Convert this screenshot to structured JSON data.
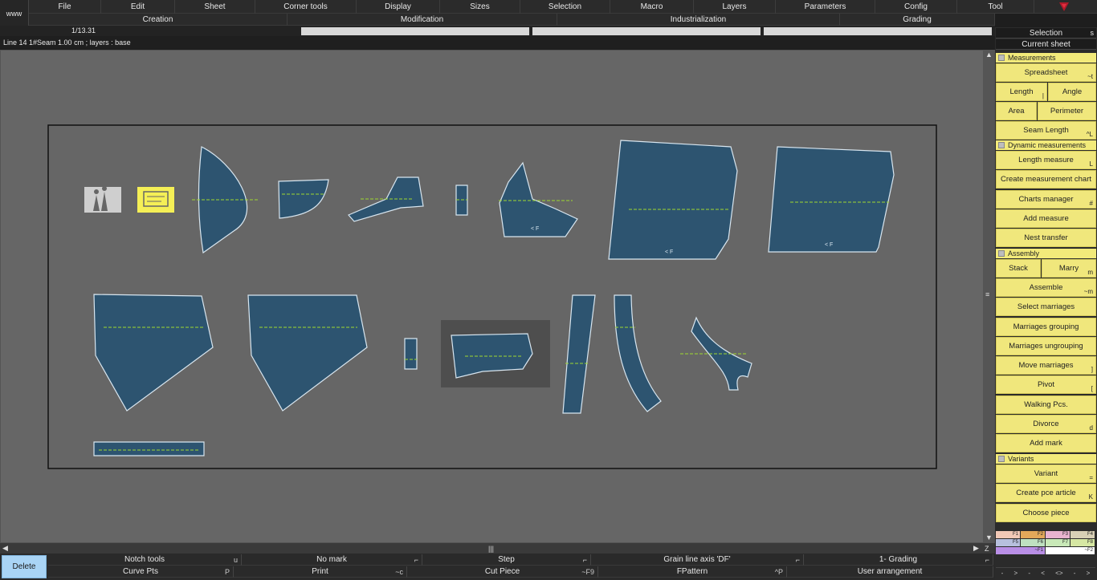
{
  "app": {
    "www_label": "www"
  },
  "menu": [
    "File",
    "Edit",
    "Sheet",
    "Corner tools",
    "Display",
    "Sizes",
    "Selection",
    "Macro",
    "Layers",
    "Parameters",
    "Config",
    "Tool"
  ],
  "modes": [
    "Creation",
    "Modification",
    "Industrialization",
    "Grading"
  ],
  "scale": "1/13.31",
  "info": "Line 14 1#Seam 1.00 cm ;     layers :  base",
  "panel": {
    "selection": {
      "label": "Selection",
      "shortcut": "s"
    },
    "current_sheet": "Current sheet",
    "sections": {
      "measurements": "Measurements",
      "dynamic": "Dynamic measurements",
      "assembly": "Assembly",
      "variants": "Variants"
    },
    "buttons": {
      "spreadsheet": {
        "label": "Spreadsheet",
        "sc": "~t"
      },
      "length": {
        "label": "Length",
        "sc": "|"
      },
      "angle": {
        "label": "Angle",
        "sc": ""
      },
      "area": {
        "label": "Area",
        "sc": ""
      },
      "perimeter": {
        "label": "Perimeter",
        "sc": ""
      },
      "seam_length": {
        "label": "Seam Length",
        "sc": "^L"
      },
      "length_measure": {
        "label": "Length measure",
        "sc": "L"
      },
      "create_chart": {
        "label": "Create measurement chart",
        "sc": ""
      },
      "charts_manager": {
        "label": "Charts manager",
        "sc": "#"
      },
      "add_measure": {
        "label": "Add measure",
        "sc": ""
      },
      "nest_transfer": {
        "label": "Nest transfer",
        "sc": ""
      },
      "stack": {
        "label": "Stack",
        "sc": ""
      },
      "marry": {
        "label": "Marry",
        "sc": "m"
      },
      "assemble": {
        "label": "Assemble",
        "sc": "~m"
      },
      "select_marriages": {
        "label": "Select marriages",
        "sc": ""
      },
      "marriages_grouping": {
        "label": "Marriages grouping",
        "sc": ""
      },
      "marriages_ungrouping": {
        "label": "Marriages ungrouping",
        "sc": ""
      },
      "move_marriages": {
        "label": "Move marriages",
        "sc": "]"
      },
      "pivot": {
        "label": "Pivot",
        "sc": "["
      },
      "walking_pcs": {
        "label": "Walking Pcs.",
        "sc": ""
      },
      "divorce": {
        "label": "Divorce",
        "sc": "d"
      },
      "add_mark": {
        "label": "Add mark",
        "sc": ""
      },
      "variant": {
        "label": "Variant",
        "sc": "="
      },
      "create_pce_article": {
        "label": "Create pce article",
        "sc": "K"
      },
      "choose_piece": {
        "label": "Choose piece",
        "sc": ""
      }
    },
    "swatch_rows": [
      [
        {
          "t": "F1",
          "c": "#f1c8b6"
        },
        {
          "t": "F2",
          "c": "#e2a85a"
        },
        {
          "t": "F3",
          "c": "#e8b3cf"
        },
        {
          "t": "F4",
          "c": "#d8d0b6"
        }
      ],
      [
        {
          "t": "F5",
          "c": "#b7c0de"
        },
        {
          "t": "F6",
          "c": "#bfe1c0"
        },
        {
          "t": "F7",
          "c": "#c9e9b8"
        },
        {
          "t": "F8",
          "c": "#d6e7a3"
        }
      ],
      [
        {
          "t": "~F1",
          "c": "#b98fe6"
        },
        {
          "t": "~F2",
          "c": "#ffffff"
        }
      ]
    ],
    "bottom_icons": [
      "-",
      ">",
      "-",
      "<",
      "<>",
      "-",
      ">"
    ]
  },
  "bottom": {
    "delete": "Delete",
    "row1": [
      {
        "label": "Notch tools",
        "sc": "u"
      },
      {
        "label": "No mark",
        "sc": "⌐"
      },
      {
        "label": "Step",
        "sc": "⌐"
      },
      {
        "label": "Grain line axis 'DF'",
        "sc": "⌐"
      },
      {
        "label": "1- Grading",
        "sc": "⌐"
      }
    ],
    "row2": [
      {
        "label": "Curve Pts",
        "sc": "P"
      },
      {
        "label": "Print",
        "sc": "~c"
      },
      {
        "label": "Cut Piece",
        "sc": "~F9"
      },
      {
        "label": "FPattern",
        "sc": "^P"
      },
      {
        "label": "User arrangement",
        "sc": ""
      }
    ]
  },
  "pieces": {
    "fill": "#2d5470",
    "stroke": "#d8e6f0",
    "grain": "#9fd830",
    "sheet_border": "#111111",
    "highlight": "#4e4e4e"
  },
  "labels": {
    "notch_mark": "< F"
  }
}
